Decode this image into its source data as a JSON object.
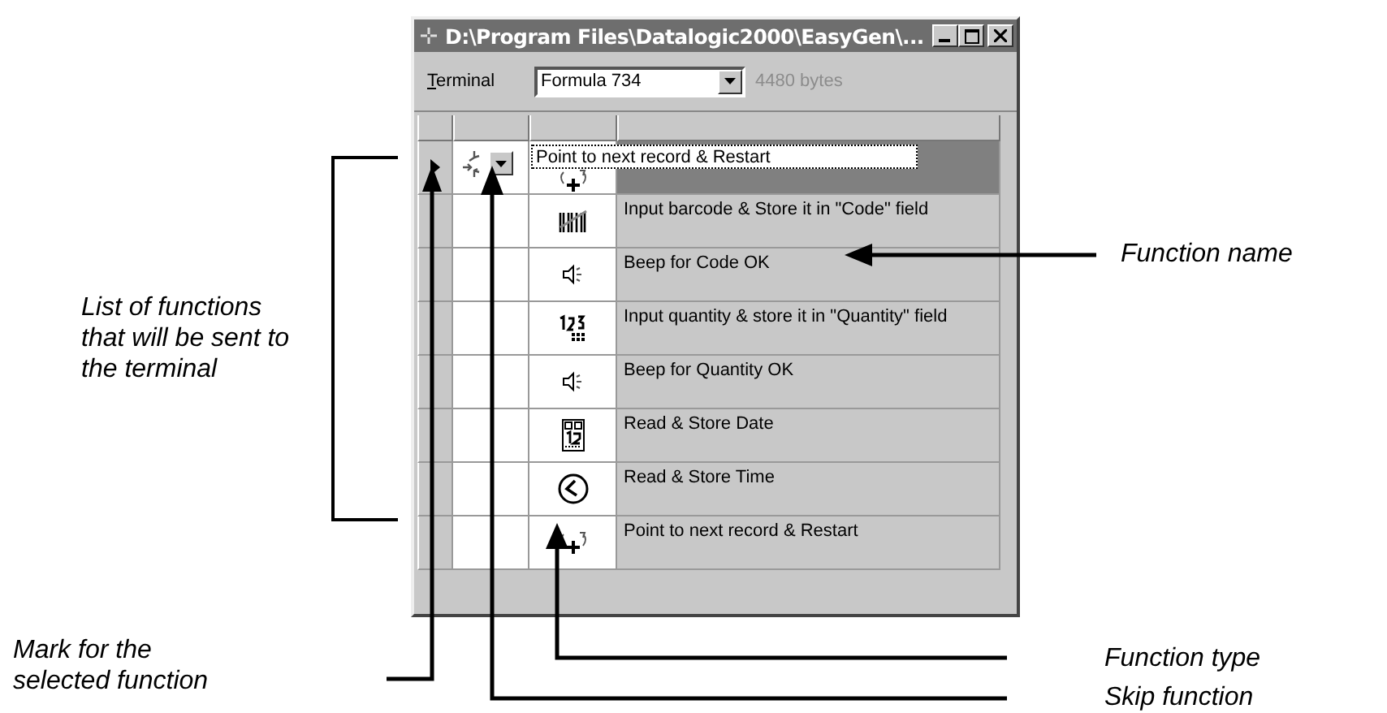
{
  "window": {
    "title": "D:\\Program Files\\Datalogic2000\\EasyGen\\..."
  },
  "toolbar": {
    "terminal_label": "Terminal",
    "terminal_value": "Formula 734",
    "size": "4480 bytes"
  },
  "rows": [
    {
      "kind": "restart",
      "name": "Point to next record & Restart",
      "selected": true,
      "editing": true
    },
    {
      "kind": "barcode",
      "name": "Input barcode & Store it in \"Code\" field",
      "selected": false,
      "editing": false
    },
    {
      "kind": "beep",
      "name": "Beep for Code OK",
      "selected": false,
      "editing": false
    },
    {
      "kind": "quantity",
      "name": "Input quantity & store it in \"Quantity\" field",
      "selected": false,
      "editing": false
    },
    {
      "kind": "beep",
      "name": "Beep for Quantity OK",
      "selected": false,
      "editing": false
    },
    {
      "kind": "date",
      "name": "Read & Store Date",
      "selected": false,
      "editing": false
    },
    {
      "kind": "time",
      "name": "Read & Store Time",
      "selected": false,
      "editing": false
    },
    {
      "kind": "restart",
      "name": "Point to next record & Restart",
      "selected": false,
      "editing": false
    }
  ],
  "callouts": {
    "list": "List of functions that will be sent to the terminal",
    "function_name": "Function name",
    "mark": "Mark for the selected function",
    "function_type": "Function type",
    "skip": "Skip function"
  }
}
